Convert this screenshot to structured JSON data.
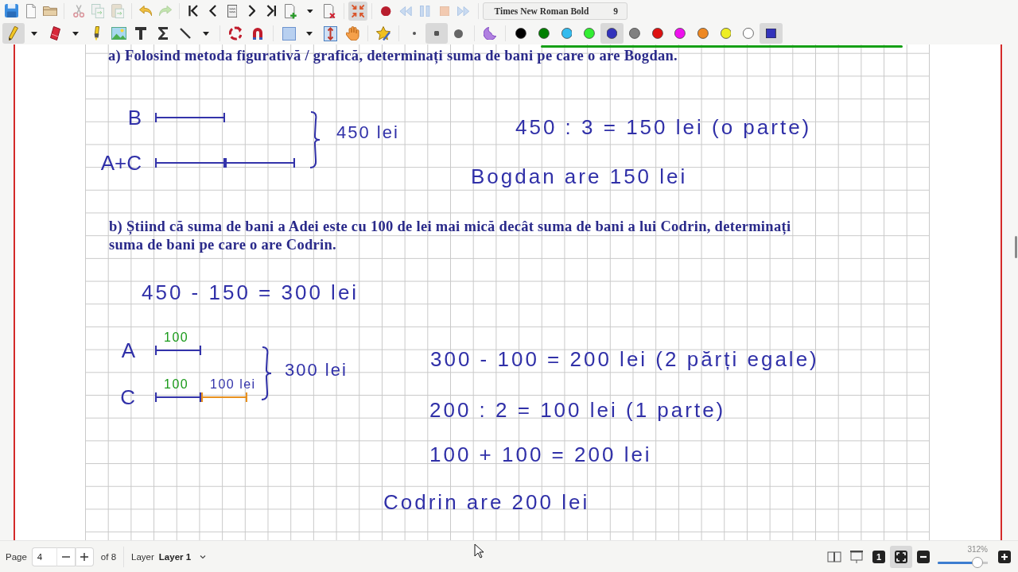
{
  "toolbar": {
    "row_1": [
      [
        {
          "kind": "save",
          "disabled": false,
          "on": false
        },
        {
          "kind": "new",
          "disabled": false,
          "on": false
        },
        {
          "kind": "open",
          "disabled": false,
          "on": false
        }
      ],
      [
        {
          "kind": "cut",
          "disabled": true,
          "on": false
        },
        {
          "kind": "copy",
          "disabled": true,
          "on": false
        },
        {
          "kind": "paste",
          "disabled": true,
          "on": false
        }
      ],
      [
        {
          "kind": "undo",
          "disabled": false,
          "on": false
        },
        {
          "kind": "redo",
          "disabled": true,
          "on": false
        }
      ],
      [
        {
          "kind": "first",
          "disabled": false,
          "on": false
        },
        {
          "kind": "previous",
          "disabled": false,
          "on": false
        },
        {
          "kind": "goto",
          "disabled": false,
          "on": false
        },
        {
          "kind": "next",
          "disabled": false,
          "on": false
        },
        {
          "kind": "last",
          "disabled": false,
          "on": false
        },
        {
          "kind": "add",
          "disabled": false,
          "on": false
        },
        {
          "kind": "dropdown",
          "disabled": false,
          "on": false
        },
        {
          "kind": "delete",
          "disabled": false,
          "on": false
        }
      ],
      [
        {
          "kind": "fullscreen",
          "disabled": false,
          "on": true
        }
      ],
      [
        {
          "kind": "record",
          "disabled": false,
          "on": false
        },
        {
          "kind": "rewind",
          "disabled": true,
          "on": false
        },
        {
          "kind": "pause",
          "disabled": true,
          "on": false
        },
        {
          "kind": "stop",
          "disabled": true,
          "on": false
        },
        {
          "kind": "forward",
          "disabled": true,
          "on": false
        }
      ]
    ],
    "font_button": {
      "font": "Times New Roman Bold",
      "size": "9"
    },
    "row_2": [
      [
        {
          "kind": "pen",
          "selected": true
        },
        {
          "kind": "dropdown",
          "selected": false
        },
        {
          "kind": "eraser",
          "selected": false
        },
        {
          "kind": "dropdown",
          "selected": false
        },
        {
          "kind": "highlighter",
          "selected": false
        },
        {
          "kind": "image",
          "selected": false
        },
        {
          "kind": "text",
          "selected": false
        },
        {
          "kind": "formula",
          "selected": false
        },
        {
          "kind": "line",
          "selected": false
        },
        {
          "kind": "dropdown",
          "selected": false
        }
      ],
      [
        {
          "kind": "rotation",
          "selected": false
        },
        {
          "kind": "magnet",
          "selected": false
        }
      ],
      [
        {
          "kind": "rectangle",
          "selected": false
        },
        {
          "kind": "dropdown",
          "selected": false
        },
        {
          "kind": "space",
          "selected": false
        },
        {
          "kind": "hand",
          "selected": false
        }
      ],
      [
        {
          "kind": "favorite",
          "selected": false
        }
      ],
      [
        {
          "kind": "thin",
          "selected": false
        },
        {
          "kind": "medium",
          "selected": true
        },
        {
          "kind": "thick",
          "selected": false
        }
      ],
      [
        {
          "kind": "fill",
          "selected": false
        }
      ],
      [
        {
          "kind": "color",
          "color": "#000000",
          "selected": false
        },
        {
          "kind": "color",
          "color": "#008000",
          "selected": false
        },
        {
          "kind": "color",
          "color": "#33bbee",
          "selected": false
        },
        {
          "kind": "color",
          "color": "#33ee33",
          "selected": false
        },
        {
          "kind": "color",
          "color": "#3333bb",
          "selected": true
        },
        {
          "kind": "color",
          "color": "#808080",
          "selected": false
        },
        {
          "kind": "color",
          "color": "#dd1111",
          "selected": false
        },
        {
          "kind": "color",
          "color": "#ee11ee",
          "selected": false
        },
        {
          "kind": "color",
          "color": "#ee8822",
          "selected": false
        },
        {
          "kind": "color",
          "color": "#eeee22",
          "selected": false
        },
        {
          "kind": "color",
          "color": "#ffffff",
          "selected": false
        },
        {
          "kind": "custom",
          "color": "#3333bb",
          "selected": true
        }
      ]
    ]
  },
  "page": {
    "question_a": "a) Folosind metoda figurativă / grafică, determinați suma de bani pe care o are Bogdan.",
    "diagram_a": {
      "rows": [
        {
          "label": "B",
          "segments": [
            {
              "color": "#3333aa"
            }
          ]
        },
        {
          "label": "A+C",
          "segments": [
            {
              "color": "#3333aa"
            },
            {
              "color": "#3333aa"
            }
          ]
        }
      ],
      "total": "450 lei"
    },
    "work_a": [
      "450 : 3 = 150 lei (o parte)",
      "Bogdan are 150 lei"
    ],
    "question_b": "b) Știind că suma de bani a Adei este cu 100 de lei mai mică decât suma de bani a lui Codrin, determinați suma de bani pe care o are Codrin.",
    "work_b_1": "450 - 150 = 300 lei",
    "diagram_b": {
      "rows": [
        {
          "label": "A",
          "segments": [
            {
              "color": "#3333aa",
              "label": {
                "text": "100",
                "color": "#1a9a1a"
              }
            }
          ]
        },
        {
          "label": "C",
          "segments": [
            {
              "color": "#3333aa",
              "label": {
                "text": "100",
                "color": "#1a9a1a"
              }
            },
            {
              "color": "#e8901e",
              "label": {
                "text": "100 lei",
                "color": "#3333aa"
              }
            }
          ]
        }
      ],
      "total": "300 lei"
    },
    "work_b_2": [
      "300 - 100 = 200 lei (2 părți egale)",
      "200 : 2 = 100 lei (1 parte)",
      "100 + 100 = 200 lei",
      "Codrin are 200 lei"
    ]
  },
  "status_bar": {
    "page_label": "Page",
    "page": "4",
    "page_total": "of 8",
    "layer_label": "Layer",
    "layer": "Layer 1",
    "view_buttons": [
      {
        "kind": "two-pages",
        "selected": false
      },
      {
        "kind": "presentation",
        "selected": false
      },
      {
        "kind": "single",
        "label": "1",
        "selected": false
      },
      {
        "kind": "fit",
        "selected": true
      }
    ],
    "zoom": {
      "reading": "312%",
      "level": 0.79
    }
  }
}
